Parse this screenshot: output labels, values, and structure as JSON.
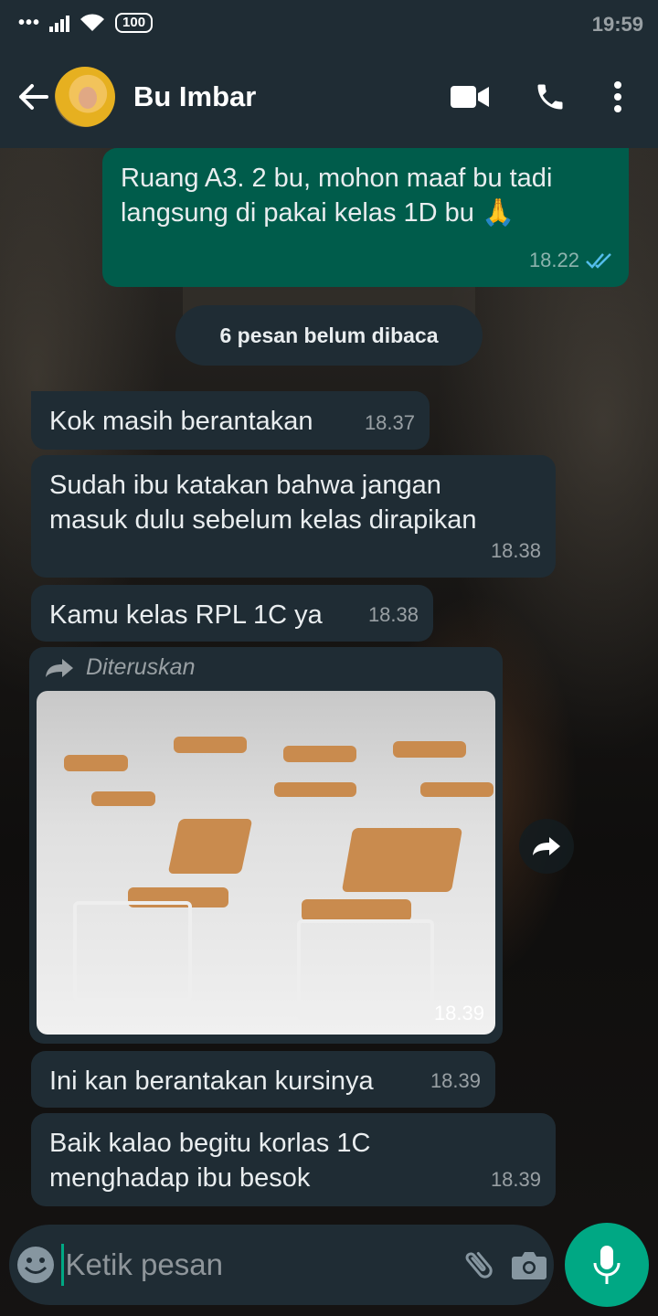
{
  "status_bar": {
    "time": "19:59",
    "dots": "•••",
    "battery": "100"
  },
  "header": {
    "contact_name": "Bu Imbar"
  },
  "messages": [
    {
      "lines": [
        "Ruang A3. 2 bu, mohon maaf bu tadi",
        "langsung di pakai kelas 1D bu 🙏"
      ],
      "time": "18.22"
    },
    {
      "lines": [
        "Kok masih berantakan"
      ],
      "time": "18.37"
    },
    {
      "lines": [
        "Sudah ibu katakan bahwa jangan",
        "masuk dulu sebelum kelas dirapikan"
      ],
      "time": "18.38"
    },
    {
      "lines": [
        "Kamu kelas RPL 1C ya"
      ],
      "time": "18.38"
    },
    {
      "forward_label": "Diteruskan",
      "time": "18.39"
    },
    {
      "lines": [
        "Ini kan berantakan kursinya"
      ],
      "time": "18.39"
    },
    {
      "lines": [
        "Baik kalao begitu korlas 1C",
        "menghadap ibu besok"
      ],
      "time": "18.39"
    }
  ],
  "unread_banner": "6 pesan belum dibaca",
  "composer": {
    "placeholder": "Ketik pesan"
  },
  "colors": {
    "accent": "#00a884",
    "outgoing_bubble": "#005c4b",
    "incoming_bubble": "#1f2c34",
    "read_ticks": "#53bdeb"
  },
  "icons": [
    "back-arrow-icon",
    "video-call-icon",
    "phone-icon",
    "more-vert-icon",
    "double-check-icon",
    "forward-icon",
    "emoji-icon",
    "attach-icon",
    "camera-icon",
    "mic-icon"
  ]
}
